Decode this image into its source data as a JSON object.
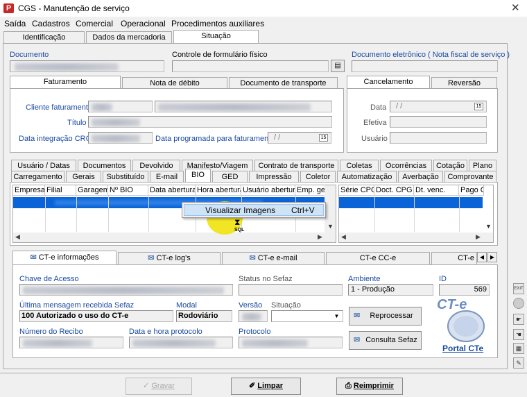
{
  "window": {
    "title": "CGS - Manutenção de serviço",
    "app_icon": "P"
  },
  "menu": [
    "Saída",
    "Cadastros",
    "Comercial",
    "Operacional",
    "Procedimentos auxiliares"
  ],
  "top_tabs": [
    "Identificação",
    "Dados da mercadoria",
    "Situação"
  ],
  "documento": {
    "label": "Documento",
    "controle_label": "Controle de formulário físico",
    "doc_eletronico_label": "Documento eletrônico ( Nota fiscal de serviço )"
  },
  "fat_tabs": [
    "Faturamento",
    "Nota de débito",
    "Documento de transporte"
  ],
  "fat": {
    "cliente_label": "Cliente faturamento",
    "titulo_label": "Título",
    "data_int_label": "Data integração CRC",
    "data_prog_label": "Data programada para faturamento",
    "data_prog_value": "/ /"
  },
  "cancel_tabs": [
    "Cancelamento",
    "Reversão"
  ],
  "cancel": {
    "data_label": "Data",
    "data_value": "/ /",
    "efetiva_label": "Efetiva",
    "usuario_label": "Usuário"
  },
  "tabs_row1": [
    "Usuário / Datas",
    "Documentos",
    "Devolvido",
    "Manifesto/Viagem",
    "Contrato de transporte",
    "Coletas",
    "Ocorrências",
    "Cotação",
    "Plano"
  ],
  "tabs_row2": [
    "Carregamento",
    "Gerais",
    "Substituído",
    "E-mail",
    "BIO",
    "GED",
    "Impressão",
    "Coletor",
    "Automatização",
    "Averbação",
    "Comprovante"
  ],
  "grid_left_cols": [
    "Empresa",
    "Filial",
    "Garagem",
    "Nº BIO",
    "Data abertura",
    "Hora abertura",
    "Usuário abertura",
    "Emp. ger"
  ],
  "grid_right_cols": [
    "Série CPG",
    "Doct. CPG",
    "Dt. venc.",
    "Pago C"
  ],
  "context_menu": {
    "item": "Visualizar Imagens",
    "shortcut": "Ctrl+V"
  },
  "cursor_label": "SQL",
  "cte_tabs": [
    "CT-e informações",
    "CT-e log's",
    "CT-e e-mail",
    "CT-e CC-e",
    "CT-e"
  ],
  "cte": {
    "chave_label": "Chave de Acesso",
    "status_label": "Status no Sefaz",
    "ambiente_label": "Ambiente",
    "ambiente_value": "1 - Produção",
    "id_label": "ID",
    "id_value": "569",
    "ultima_label": "Última mensagem recebida Sefaz",
    "ultima_value": "100 Autorizado o uso do CT-e",
    "modal_label": "Modal",
    "modal_value": "Rodoviário",
    "versao_label": "Versão",
    "situacao_label": "Situação",
    "recibo_label": "Número do Recibo",
    "datahora_label": "Data e hora protocolo",
    "protocolo_label": "Protocolo",
    "reprocessar": "Reprocessar",
    "consulta": "Consulta Sefaz",
    "portal": "Portal CTe",
    "logo": "CT-e"
  },
  "bottom": {
    "gravar": "Gravar",
    "limpar": "Limpar",
    "reimprimir": "Reimprimir"
  },
  "colors": {
    "selection": "#0a64d7",
    "highlight": "#f0e000",
    "link": "#1a4aa0"
  }
}
